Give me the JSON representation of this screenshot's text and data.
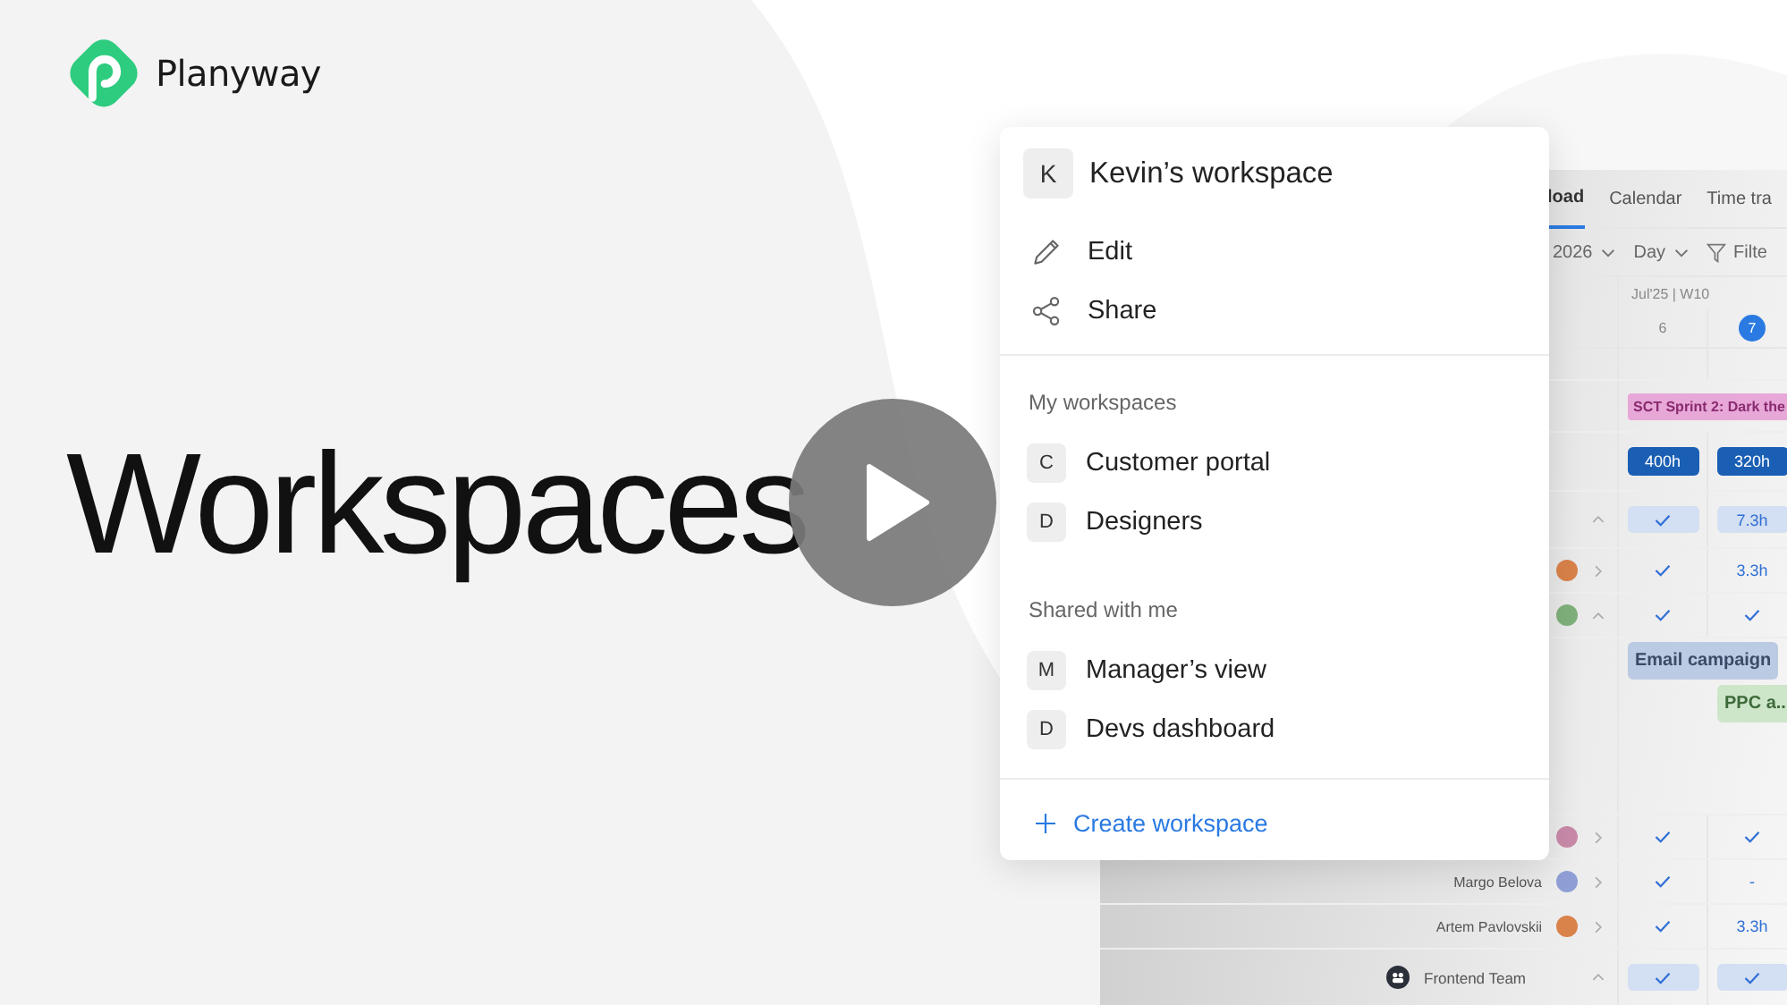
{
  "brand": {
    "name": "Planyway"
  },
  "hero": {
    "title": "Workspaces"
  },
  "menu": {
    "current": {
      "initial": "K",
      "name": "Kevin’s workspace"
    },
    "actions": [
      {
        "kind": "edit",
        "label": "Edit"
      },
      {
        "kind": "share",
        "label": "Share"
      }
    ],
    "sections": [
      {
        "title": "My workspaces",
        "items": [
          {
            "initial": "C",
            "name": "Customer portal"
          },
          {
            "initial": "D",
            "name": "Designers"
          }
        ]
      },
      {
        "title": "Shared with me",
        "items": [
          {
            "initial": "M",
            "name": "Manager’s view"
          },
          {
            "initial": "D",
            "name": "Devs dashboard"
          }
        ]
      }
    ],
    "create": {
      "label": "Create workspace"
    }
  },
  "app": {
    "tabs": [
      {
        "label": "load",
        "selected": true
      },
      {
        "label": "Calendar",
        "selected": false
      },
      {
        "label": "Time tra",
        "selected": false
      }
    ],
    "toolbar": {
      "period": "2026",
      "scale": "Day",
      "filter": "Filte"
    },
    "week": "Jul'25 | W10",
    "days": [
      {
        "label": "6",
        "today": false
      },
      {
        "label": "7",
        "today": true
      }
    ],
    "rows": [
      {
        "kind": "event",
        "label": "SCT Sprint 2: Dark the",
        "color": "#e7a8d8"
      },
      {
        "kind": "totals",
        "cells": [
          {
            "kind": "text",
            "text": "400h"
          },
          {
            "kind": "text",
            "text": "320h"
          }
        ]
      },
      {
        "kind": "group",
        "expanded": true,
        "cells": [
          {
            "kind": "check"
          },
          {
            "kind": "text",
            "text": "7.3h"
          }
        ]
      },
      {
        "kind": "person",
        "color": "#d9824a",
        "expanded": false,
        "cells": [
          {
            "kind": "check"
          },
          {
            "kind": "text",
            "text": "3.3h"
          }
        ]
      },
      {
        "kind": "person",
        "color": "#7fb07a",
        "expanded": true,
        "cells": [
          {
            "kind": "check"
          },
          {
            "kind": "check"
          }
        ]
      },
      {
        "kind": "tasks",
        "tasks": [
          {
            "label": "Email campaign",
            "color": "#bccbe4"
          },
          {
            "label": "PPC a...",
            "color": "#cde6c9"
          }
        ]
      },
      {
        "kind": "person",
        "color": "#c98aa8",
        "expanded": false,
        "cells": [
          {
            "kind": "check"
          },
          {
            "kind": "check"
          }
        ]
      },
      {
        "kind": "person",
        "name": "Margo Belova",
        "color": "#8f9fd6",
        "expanded": false,
        "cells": [
          {
            "kind": "check"
          },
          {
            "kind": "text",
            "text": "-"
          }
        ]
      },
      {
        "kind": "person",
        "name": "Artem Pavlovskii",
        "color": "#d9824a",
        "expanded": false,
        "cells": [
          {
            "kind": "check"
          },
          {
            "kind": "text",
            "text": "3.3h"
          }
        ]
      },
      {
        "kind": "team",
        "name": "Frontend Team",
        "expanded": true,
        "cells": [
          {
            "kind": "check"
          },
          {
            "kind": "check"
          }
        ]
      }
    ]
  }
}
